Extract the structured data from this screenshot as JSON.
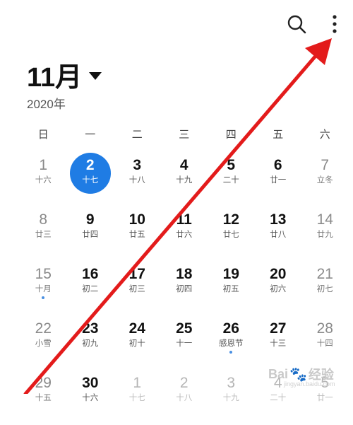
{
  "header": {
    "month": "11月",
    "year": "2020年",
    "search_icon": "search-icon",
    "more_icon": "more-vertical-icon"
  },
  "weekdays": [
    "日",
    "一",
    "二",
    "三",
    "四",
    "五",
    "六"
  ],
  "weeks": [
    [
      {
        "num": "1",
        "lunar": "十六",
        "type": "weekend"
      },
      {
        "num": "2",
        "lunar": "十七",
        "type": "selected"
      },
      {
        "num": "3",
        "lunar": "十八",
        "type": "normal"
      },
      {
        "num": "4",
        "lunar": "十九",
        "type": "normal"
      },
      {
        "num": "5",
        "lunar": "二十",
        "type": "normal"
      },
      {
        "num": "6",
        "lunar": "廿一",
        "type": "normal"
      },
      {
        "num": "7",
        "lunar": "立冬",
        "type": "weekend"
      }
    ],
    [
      {
        "num": "8",
        "lunar": "廿三",
        "type": "weekend"
      },
      {
        "num": "9",
        "lunar": "廿四",
        "type": "normal"
      },
      {
        "num": "10",
        "lunar": "廿五",
        "type": "normal"
      },
      {
        "num": "11",
        "lunar": "廿六",
        "type": "normal"
      },
      {
        "num": "12",
        "lunar": "廿七",
        "type": "normal"
      },
      {
        "num": "13",
        "lunar": "廿八",
        "type": "normal"
      },
      {
        "num": "14",
        "lunar": "廿九",
        "type": "weekend"
      }
    ],
    [
      {
        "num": "15",
        "lunar": "十月",
        "type": "weekend",
        "event": true
      },
      {
        "num": "16",
        "lunar": "初二",
        "type": "normal"
      },
      {
        "num": "17",
        "lunar": "初三",
        "type": "normal"
      },
      {
        "num": "18",
        "lunar": "初四",
        "type": "normal"
      },
      {
        "num": "19",
        "lunar": "初五",
        "type": "normal"
      },
      {
        "num": "20",
        "lunar": "初六",
        "type": "normal"
      },
      {
        "num": "21",
        "lunar": "初七",
        "type": "weekend"
      }
    ],
    [
      {
        "num": "22",
        "lunar": "小雪",
        "type": "weekend"
      },
      {
        "num": "23",
        "lunar": "初九",
        "type": "normal"
      },
      {
        "num": "24",
        "lunar": "初十",
        "type": "normal"
      },
      {
        "num": "25",
        "lunar": "十一",
        "type": "normal"
      },
      {
        "num": "26",
        "lunar": "感恩节",
        "type": "normal",
        "event": true
      },
      {
        "num": "27",
        "lunar": "十三",
        "type": "normal"
      },
      {
        "num": "28",
        "lunar": "十四",
        "type": "weekend"
      }
    ],
    [
      {
        "num": "29",
        "lunar": "十五",
        "type": "weekend"
      },
      {
        "num": "30",
        "lunar": "十六",
        "type": "normal"
      },
      {
        "num": "1",
        "lunar": "十七",
        "type": "other"
      },
      {
        "num": "2",
        "lunar": "十八",
        "type": "other"
      },
      {
        "num": "3",
        "lunar": "十九",
        "type": "other"
      },
      {
        "num": "4",
        "lunar": "二十",
        "type": "other"
      },
      {
        "num": "5",
        "lunar": "廿一",
        "type": "other"
      }
    ]
  ],
  "colors": {
    "selected": "#1f7ce4",
    "annotation_arrow": "#e31b1b",
    "event_dot": "#4a90e2"
  },
  "watermark": {
    "text_left": "Bai",
    "text_right": "经验",
    "sub": "jingyan.baidu.com"
  }
}
